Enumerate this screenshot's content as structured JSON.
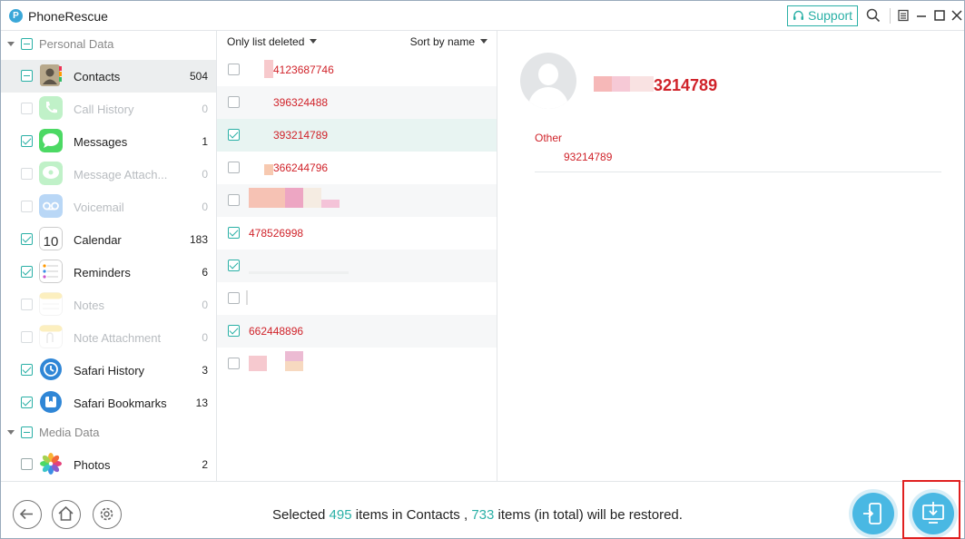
{
  "app": {
    "title": "PhoneRescue",
    "support_label": "Support"
  },
  "sidebar": {
    "groups": [
      {
        "label": "Personal Data"
      },
      {
        "label": "Media Data"
      }
    ],
    "items": [
      {
        "label": "Contacts",
        "count": "504",
        "state": "partial",
        "icon": "contacts-icon"
      },
      {
        "label": "Call History",
        "count": "0",
        "state": "disabled",
        "icon": "phone-icon"
      },
      {
        "label": "Messages",
        "count": "1",
        "state": "checked",
        "icon": "messages-icon"
      },
      {
        "label": "Message Attach...",
        "count": "0",
        "state": "disabled",
        "icon": "message-attachment-icon"
      },
      {
        "label": "Voicemail",
        "count": "0",
        "state": "disabled",
        "icon": "voicemail-icon"
      },
      {
        "label": "Calendar",
        "count": "183",
        "state": "checked",
        "icon": "calendar-icon",
        "icon_text": "10"
      },
      {
        "label": "Reminders",
        "count": "6",
        "state": "checked",
        "icon": "reminders-icon"
      },
      {
        "label": "Notes",
        "count": "0",
        "state": "disabled",
        "icon": "notes-icon"
      },
      {
        "label": "Note Attachment",
        "count": "0",
        "state": "disabled",
        "icon": "note-attachment-icon"
      },
      {
        "label": "Safari History",
        "count": "3",
        "state": "checked",
        "icon": "safari-history-icon"
      },
      {
        "label": "Safari Bookmarks",
        "count": "13",
        "state": "checked",
        "icon": "safari-bookmarks-icon"
      },
      {
        "label": "Photos",
        "count": "2",
        "state": "unchecked",
        "icon": "photos-icon"
      }
    ]
  },
  "list": {
    "filter_label": "Only list deleted",
    "sort_label": "Sort by name",
    "rows": [
      {
        "number": "4123687746",
        "checked": false
      },
      {
        "number": "396324488",
        "checked": false
      },
      {
        "number": "393214789",
        "checked": true
      },
      {
        "number": "366244796",
        "checked": false
      },
      {
        "number": "",
        "checked": false
      },
      {
        "number": "478526998",
        "checked": true
      },
      {
        "number": "",
        "checked": true
      },
      {
        "number": "",
        "checked": false
      },
      {
        "number": "662448896",
        "checked": true
      },
      {
        "number": "",
        "checked": false
      }
    ]
  },
  "detail": {
    "name": "3214789",
    "field_label": "Other",
    "field_value": "93214789"
  },
  "status": {
    "prefix": "Selected",
    "selected_count": "495",
    "middle": "items in Contacts ,",
    "total_count": "733",
    "suffix": "items (in total) will be restored."
  },
  "colors": {
    "accent": "#2ab0a6",
    "highlight": "#d0232a",
    "button": "#49b8e3"
  }
}
